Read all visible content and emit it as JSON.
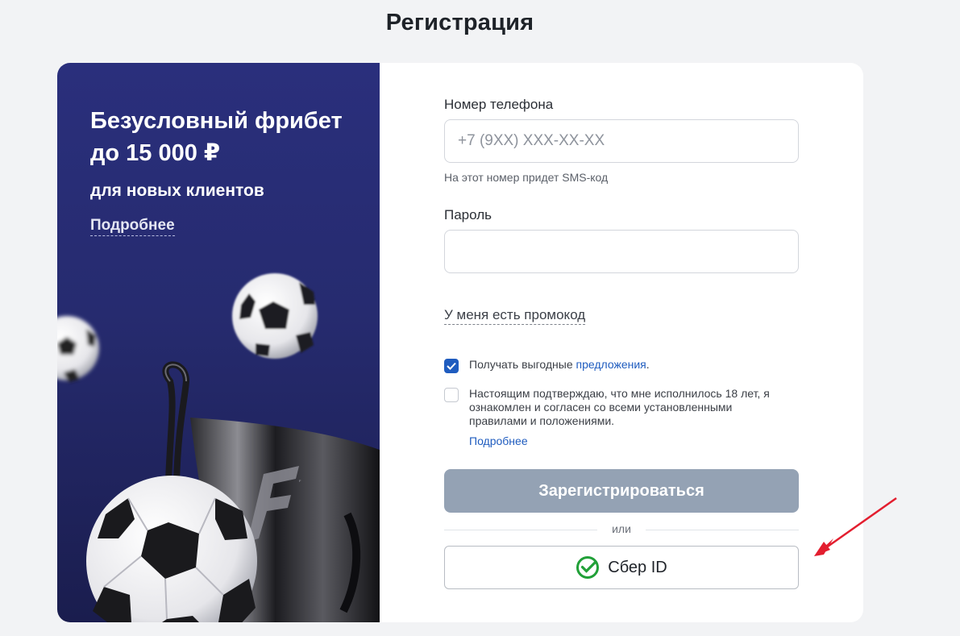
{
  "page": {
    "title": "Регистрация"
  },
  "promo": {
    "headline": "Безусловный фрибет до 15 000 ₽",
    "subline": "для новых клиентов",
    "more_label": "Подробнее",
    "art_logo": "F"
  },
  "form": {
    "phone": {
      "label": "Номер телефона",
      "placeholder": "+7 (9XX) XXX-XX-XX",
      "value": "",
      "hint": "На этот номер придет SMS-код"
    },
    "password": {
      "label": "Пароль",
      "value": ""
    },
    "promocode_link": "У меня есть промокод",
    "offers": {
      "checked": true,
      "text": "Получать выгодные ",
      "link": "предложения",
      "after": "."
    },
    "age": {
      "checked": false,
      "text": "Настоящим подтверждаю, что мне исполнилось 18 лет, я ознакомлен и согласен со всеми установленными правилами и положениями.",
      "more_label": "Подробнее"
    },
    "register_button": "Зарегистрироваться",
    "or_label": "или",
    "sber_button": "Сбер ID"
  },
  "colors": {
    "promo_background": "#2a2f7c",
    "accent_link": "#1f5cbf",
    "register_disabled": "#94a2b4",
    "sber_green": "#21a038",
    "annotation_arrow": "#e31e2f"
  },
  "icons": [
    "check-icon",
    "sber-logo-icon",
    "soccer-ball-icon",
    "trophy-icon",
    "annotation-arrow-icon"
  ]
}
